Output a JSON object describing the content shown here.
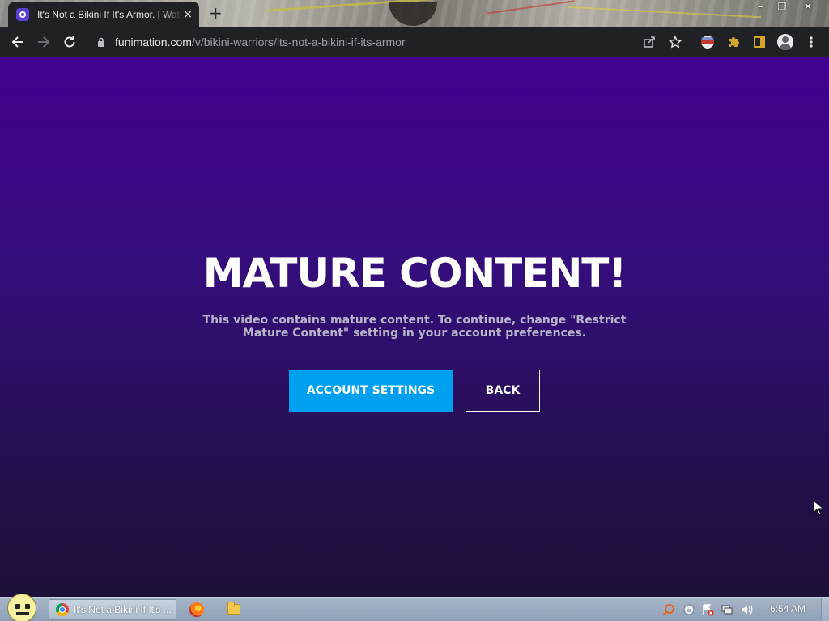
{
  "browser": {
    "tab": {
      "title": "It's Not a Bikini If It's Armor. | Watch on Funimation",
      "close_label": "×"
    },
    "new_tab_label": "+",
    "window_controls": {
      "minimize": "–",
      "restore": "❐",
      "close": "✕"
    },
    "toolbar": {
      "url_host": "funimation.com",
      "url_path": "/v/bikini-warriors/its-not-a-bikini-if-its-armor"
    }
  },
  "page": {
    "headline": "MATURE CONTENT!",
    "message": "This video contains mature content. To continue, change \"Restrict Mature Content\" setting in your account preferences.",
    "primary_button": "ACCOUNT SETTINGS",
    "secondary_button": "BACK"
  },
  "taskbar": {
    "active_task": "It's Not a Bikini If It's ...",
    "clock": "6:54 AM"
  },
  "colors": {
    "page_gradient_top": "#43008f",
    "page_gradient_bottom": "#1c0f37",
    "primary_button": "#00a0f0",
    "headline_text": "#ffffff",
    "message_text": "#b8b3c9"
  }
}
